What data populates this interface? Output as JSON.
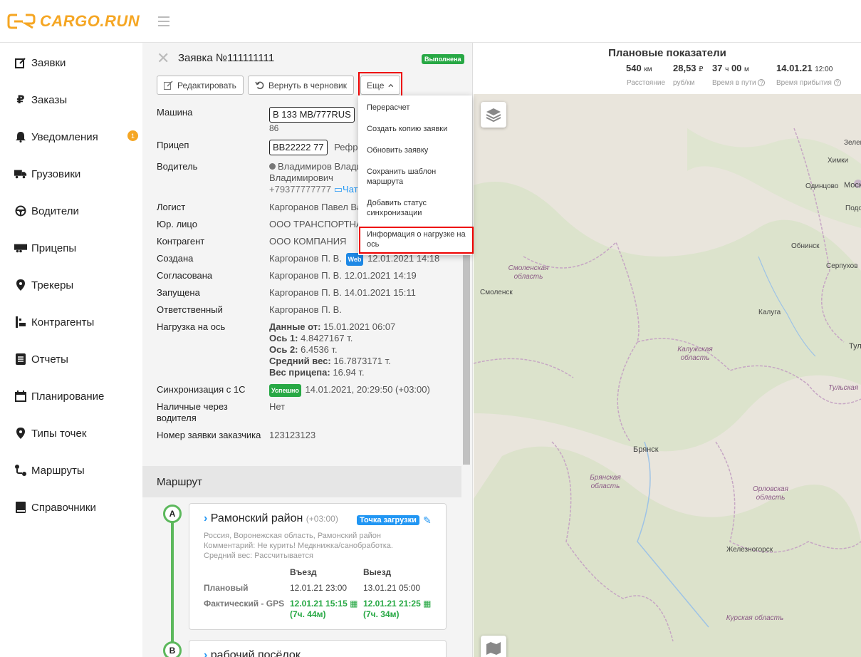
{
  "app": {
    "logo_text": "CARGO.RUN",
    "brand_color": "#f5a623"
  },
  "sidebar": {
    "items": [
      {
        "label": "Заявки",
        "icon": "edit-icon"
      },
      {
        "label": "Заказы",
        "icon": "ruble-icon"
      },
      {
        "label": "Уведомления",
        "icon": "bell-icon",
        "badge": "1"
      },
      {
        "label": "Грузовики",
        "icon": "truck-icon"
      },
      {
        "label": "Водители",
        "icon": "steering-wheel-icon"
      },
      {
        "label": "Прицепы",
        "icon": "trailer-icon"
      },
      {
        "label": "Трекеры",
        "icon": "map-pin-icon"
      },
      {
        "label": "Контрагенты",
        "icon": "contacts-icon"
      },
      {
        "label": "Отчеты",
        "icon": "report-icon"
      },
      {
        "label": "Планирование",
        "icon": "calendar-icon"
      },
      {
        "label": "Типы точек",
        "icon": "map-pin-icon"
      },
      {
        "label": "Маршруты",
        "icon": "route-icon"
      },
      {
        "label": "Справочники",
        "icon": "book-icon"
      }
    ]
  },
  "order": {
    "title": "Заявка №111111111",
    "status": "Выполнена",
    "buttons": {
      "edit": "Редактировать",
      "revert": "Вернуть в черновик",
      "more": "Еще"
    },
    "fields": {
      "vehicle_label": "Машина",
      "vehicle_plate": "В 133 МВ/777RUS",
      "vehicle_sub": "86",
      "trailer_label": "Прицеп",
      "trailer_plate": "ВВ22222 77",
      "trailer_type": "Рефр",
      "driver_label": "Водитель",
      "driver_name_1": "Владимиров Влади",
      "driver_name_2": "Владимирович",
      "driver_phone": "+79377777777",
      "driver_chat": "Чат",
      "logist_label": "Логист",
      "logist_value": "Каргоранов Павел Ва",
      "legal_label": "Юр. лицо",
      "legal_value": "ООО ТРАНСПОРТНАЯ",
      "contractor_label": "Контрагент",
      "contractor_value": "ООО КОМПАНИЯ",
      "created_label": "Создана",
      "created_by": "Каргоранов П. В.",
      "created_badge": "Web",
      "created_date": "12.01.2021 14:18",
      "agreed_label": "Согласована",
      "agreed_value": "Каргоранов П. В. 12.01.2021 14:19",
      "started_label": "Запущена",
      "started_value": "Каргоранов П. В. 14.01.2021 15:11",
      "responsible_label": "Ответственный",
      "responsible_value": "Каргоранов П. В.",
      "axle_label": "Нагрузка на ось",
      "axle_data_from_label": "Данные от:",
      "axle_data_from": "15.01.2021 06:07",
      "axle1_label": "Ось 1:",
      "axle1": "4.8427167 т.",
      "axle2_label": "Ось 2:",
      "axle2": "6.4536 т.",
      "avg_weight_label": "Средний вес:",
      "avg_weight": "16.7873171 т.",
      "trailer_weight_label": "Вес прицепа:",
      "trailer_weight": "16.94 т.",
      "sync_label": "Синхронизация с 1С",
      "sync_badge": "Успешно",
      "sync_value": "14.01.2021, 20:29:50 (+03:00)",
      "cash_label": "Наличные через водителя",
      "cash_value": "Нет",
      "customer_no_label": "Номер заявки заказчика",
      "customer_no_value": "123123123"
    }
  },
  "dropdown": {
    "items": [
      "Перерасчет",
      "Создать копию заявки",
      "Обновить заявку",
      "Сохранить шаблон маршрута",
      "Добавить статус синхронизации",
      "Информация о нагрузке на ось"
    ]
  },
  "route": {
    "title": "Маршрут",
    "points": [
      {
        "marker": "A",
        "name": "Рамонский район",
        "tz": "(+03:00)",
        "type": "Точка загрузки",
        "address": "Россия, Воронежская область, Рамонский район",
        "comment": "Комментарий: Не курить! Медкнижка/санобработка.",
        "avg_weight": "Средний вес: Рассчитывается",
        "col_in": "Въезд",
        "col_out": "Выезд",
        "plan_label": "Плановый",
        "plan_in": "12.01.21 23:00",
        "plan_out": "13.01.21 05:00",
        "fact_label": "Фактический - GPS",
        "fact_in": "12.01.21 15:15",
        "fact_in_delta": "(7ч. 44м)",
        "fact_out": "12.01.21 21:25",
        "fact_out_delta": "(7ч. 34м)"
      },
      {
        "marker": "B",
        "name": "рабочий посёлок"
      }
    ]
  },
  "plan_stats": {
    "title": "Плановые показатели",
    "distance": "540",
    "distance_unit": "км",
    "distance_label": "Расстояние",
    "rate": "28,53",
    "rate_unit": "₽",
    "rate_label": "руб/км",
    "time_h": "37",
    "time_h_unit": "ч",
    "time_m": "00",
    "time_m_unit": "м",
    "time_label": "Время в пути",
    "arrival_date": "14.01.21",
    "arrival_time": "12:00",
    "arrival_label": "Время прибытия"
  },
  "map": {
    "cities": [
      "Зеленоград",
      "Химки",
      "Одинцово",
      "Моск",
      "Подол",
      "Обнинск",
      "Серпухов",
      "Смоленск",
      "Калуга",
      "Тул",
      "Брянск",
      "Железногорск"
    ],
    "regions": [
      "Смоленская область",
      "Калужская область",
      "Тульская",
      "Брянская область",
      "Орловская область",
      "Курская область"
    ]
  }
}
